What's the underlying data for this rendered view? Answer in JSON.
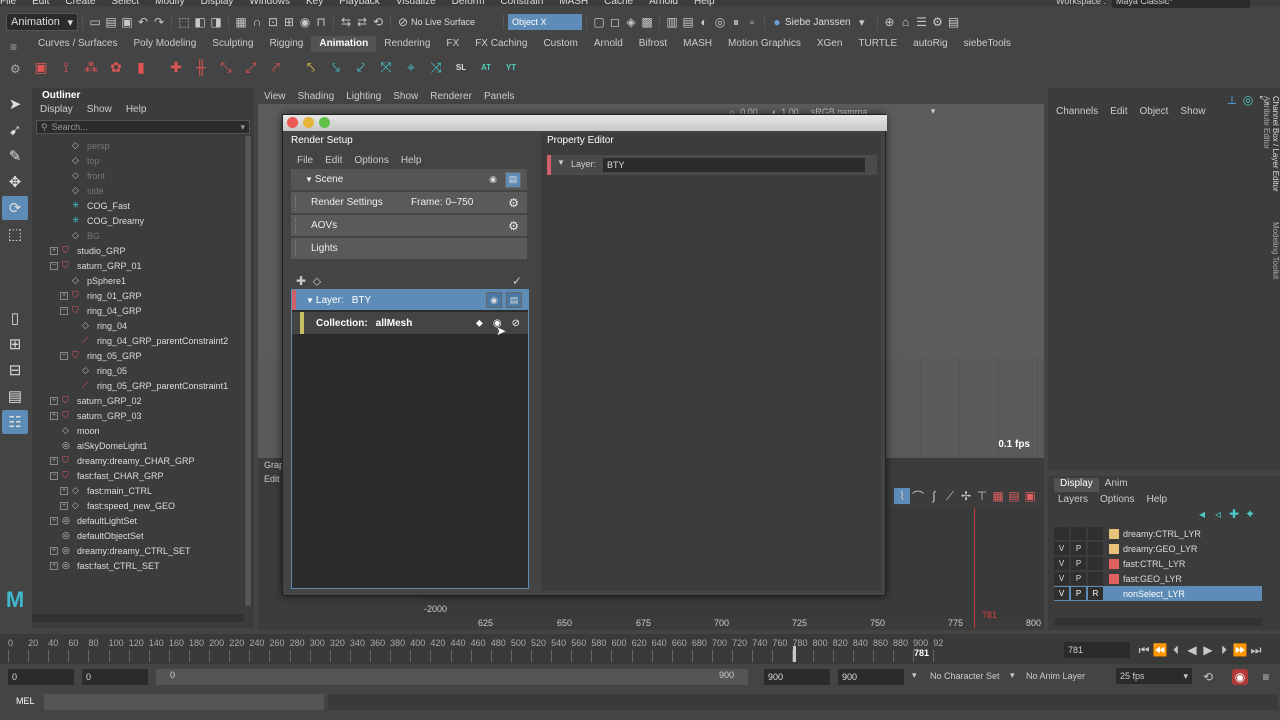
{
  "menubar": [
    "File",
    "Edit",
    "Create",
    "Select",
    "Modify",
    "Display",
    "Windows",
    "Key",
    "Playback",
    "Visualize",
    "Deform",
    "Constrain",
    "MASH",
    "Cache",
    "Arnold",
    "Help"
  ],
  "statusline": {
    "mode": "Animation",
    "live_surface": "No Live Surface",
    "symmetry": "Object X",
    "user": "Siebe Janssen",
    "workspace_label": "Workspace :",
    "workspace": "Maya Classic*"
  },
  "shelf_tabs": [
    {
      "label": "Curves / Surfaces",
      "active": false
    },
    {
      "label": "Poly Modeling",
      "active": false
    },
    {
      "label": "Sculpting",
      "active": false
    },
    {
      "label": "Rigging",
      "active": false
    },
    {
      "label": "Animation",
      "active": true
    },
    {
      "label": "Rendering",
      "active": false
    },
    {
      "label": "FX",
      "active": false
    },
    {
      "label": "FX Caching",
      "active": false
    },
    {
      "label": "Custom",
      "active": false
    },
    {
      "label": "Arnold",
      "active": false
    },
    {
      "label": "Bifrost",
      "active": false
    },
    {
      "label": "MASH",
      "active": false
    },
    {
      "label": "Motion Graphics",
      "active": false
    },
    {
      "label": "XGen",
      "active": false
    },
    {
      "label": "TURTLE",
      "active": false
    },
    {
      "label": "autoRig",
      "active": false
    },
    {
      "label": "siebeTools",
      "active": false
    }
  ],
  "shelf_text_icons": [
    "SL",
    "AT",
    "YT"
  ],
  "outliner": {
    "title": "Outliner",
    "menu": [
      "Display",
      "Show",
      "Help"
    ],
    "search_placeholder": "Search...",
    "items": [
      {
        "label": "persp",
        "dim": true,
        "indent": 1,
        "kind": "mesh",
        "exp": ""
      },
      {
        "label": "top",
        "dim": true,
        "indent": 1,
        "kind": "mesh",
        "exp": ""
      },
      {
        "label": "front",
        "dim": true,
        "indent": 1,
        "kind": "mesh",
        "exp": ""
      },
      {
        "label": "side",
        "dim": true,
        "indent": 1,
        "kind": "mesh",
        "exp": ""
      },
      {
        "label": "COG_Fast",
        "dim": false,
        "indent": 1,
        "kind": "joint",
        "exp": ""
      },
      {
        "label": "COG_Dreamy",
        "dim": false,
        "indent": 1,
        "kind": "joint",
        "exp": ""
      },
      {
        "label": "BG",
        "dim": true,
        "indent": 1,
        "kind": "mesh",
        "exp": ""
      },
      {
        "label": "studio_GRP",
        "dim": false,
        "indent": 0,
        "kind": "grp",
        "exp": "+"
      },
      {
        "label": "saturn_GRP_01",
        "dim": false,
        "indent": 0,
        "kind": "grp",
        "exp": "−"
      },
      {
        "label": "pSphere1",
        "dim": false,
        "indent": 1,
        "kind": "mesh",
        "exp": ""
      },
      {
        "label": "ring_01_GRP",
        "dim": false,
        "indent": 1,
        "kind": "grp",
        "exp": "+"
      },
      {
        "label": "ring_04_GRP",
        "dim": false,
        "indent": 1,
        "kind": "grp",
        "exp": "−"
      },
      {
        "label": "ring_04",
        "dim": false,
        "indent": 2,
        "kind": "mesh",
        "exp": ""
      },
      {
        "label": "ring_04_GRP_parentConstraint2",
        "dim": false,
        "indent": 2,
        "kind": "con",
        "exp": ""
      },
      {
        "label": "ring_05_GRP",
        "dim": false,
        "indent": 1,
        "kind": "grp",
        "exp": "−"
      },
      {
        "label": "ring_05",
        "dim": false,
        "indent": 2,
        "kind": "mesh",
        "exp": ""
      },
      {
        "label": "ring_05_GRP_parentConstraint1",
        "dim": false,
        "indent": 2,
        "kind": "con",
        "exp": ""
      },
      {
        "label": "saturn_GRP_02",
        "dim": false,
        "indent": 0,
        "kind": "grp",
        "exp": "+"
      },
      {
        "label": "saturn_GRP_03",
        "dim": false,
        "indent": 0,
        "kind": "grp",
        "exp": "+"
      },
      {
        "label": "moon",
        "dim": false,
        "indent": 0,
        "kind": "mesh",
        "exp": ""
      },
      {
        "label": "aiSkyDomeLight1",
        "dim": false,
        "indent": 0,
        "kind": "set",
        "exp": ""
      },
      {
        "label": "dreamy:dreamy_CHAR_GRP",
        "dim": false,
        "indent": 0,
        "kind": "grp",
        "exp": "+"
      },
      {
        "label": "fast:fast_CHAR_GRP",
        "dim": false,
        "indent": 0,
        "kind": "grp",
        "exp": "−"
      },
      {
        "label": "fast:main_CTRL",
        "dim": false,
        "indent": 1,
        "kind": "mesh",
        "exp": "+"
      },
      {
        "label": "fast:speed_new_GEO",
        "dim": false,
        "indent": 1,
        "kind": "mesh",
        "exp": "+"
      },
      {
        "label": "defaultLightSet",
        "dim": false,
        "indent": 0,
        "kind": "set",
        "exp": "+"
      },
      {
        "label": "defaultObjectSet",
        "dim": false,
        "indent": 0,
        "kind": "set",
        "exp": ""
      },
      {
        "label": "dreamy:dreamy_CTRL_SET",
        "dim": false,
        "indent": 0,
        "kind": "set",
        "exp": "+"
      },
      {
        "label": "fast:fast_CTRL_SET",
        "dim": false,
        "indent": 0,
        "kind": "set",
        "exp": "+"
      }
    ]
  },
  "viewport": {
    "menu": [
      "View",
      "Shading",
      "Lighting",
      "Show",
      "Renderer",
      "Panels"
    ],
    "field_a": "0.00",
    "field_b": "1.00",
    "colorspace": "sRGB gamma",
    "fps": "0.1 fps"
  },
  "graph": {
    "tab_label": "Grap",
    "menu_label": "Edit",
    "y_value": "-2000",
    "ticks": [
      "625",
      "650",
      "675",
      "700",
      "725",
      "750",
      "775",
      "800"
    ],
    "current_marker": "781"
  },
  "render_setup": {
    "title": "Render Setup",
    "menu": [
      "File",
      "Edit",
      "Options",
      "Help"
    ],
    "scene_label": "Scene",
    "render_settings_label": "Render Settings",
    "frame_label": "Frame: 0–750",
    "aovs_label": "AOVs",
    "lights_label": "Lights",
    "layer_label": "Layer:",
    "layer_name": "BTY",
    "collection_label": "Collection:",
    "collection_name": "allMesh"
  },
  "property_editor": {
    "title": "Property Editor",
    "layer_label": "Layer:",
    "layer_value": "BTY"
  },
  "channel_box": {
    "menu": [
      "Channels",
      "Edit",
      "Object",
      "Show"
    ],
    "side_labels": [
      "Channel Box / Layer Editor",
      "Modeling Toolkit",
      "Attribute Editor"
    ]
  },
  "layer_editor": {
    "tabs": [
      {
        "label": "Display",
        "active": true
      },
      {
        "label": "Anim",
        "active": false
      }
    ],
    "menu": [
      "Layers",
      "Options",
      "Help"
    ],
    "layers": [
      {
        "v": "",
        "p": "",
        "r": "",
        "color": "#e8c27a",
        "name": "dreamy:CTRL_LYR",
        "selected": false
      },
      {
        "v": "V",
        "p": "P",
        "r": "",
        "color": "#e8c27a",
        "name": "dreamy:GEO_LYR",
        "selected": false
      },
      {
        "v": "V",
        "p": "P",
        "r": "",
        "color": "#e06060",
        "name": "fast:CTRL_LYR",
        "selected": false
      },
      {
        "v": "V",
        "p": "P",
        "r": "",
        "color": "#e06060",
        "name": "fast:GEO_LYR",
        "selected": false
      },
      {
        "v": "V",
        "p": "P",
        "r": "R",
        "color": "#5d8cb6",
        "name": "nonSelect_LYR",
        "selected": true
      }
    ]
  },
  "timeline": {
    "ticks": [
      "0",
      "20",
      "40",
      "60",
      "80",
      "100",
      "120",
      "140",
      "160",
      "180",
      "200",
      "220",
      "240",
      "260",
      "280",
      "300",
      "320",
      "340",
      "360",
      "380",
      "400",
      "420",
      "440",
      "460",
      "480",
      "500",
      "520",
      "540",
      "560",
      "580",
      "600",
      "620",
      "640",
      "660",
      "680",
      "700",
      "720",
      "740",
      "760",
      "780",
      "800",
      "820",
      "840",
      "860",
      "880",
      "900",
      "92"
    ],
    "current_label": "781",
    "current_frame": "781"
  },
  "range": {
    "start": "0",
    "anim_start": "0",
    "range_start": "0",
    "range_end": "900",
    "end": "900",
    "anim_end": "900",
    "character_set": "No Character Set",
    "anim_layer": "No Anim Layer",
    "fps": "25 fps"
  },
  "command": {
    "lang": "MEL"
  }
}
